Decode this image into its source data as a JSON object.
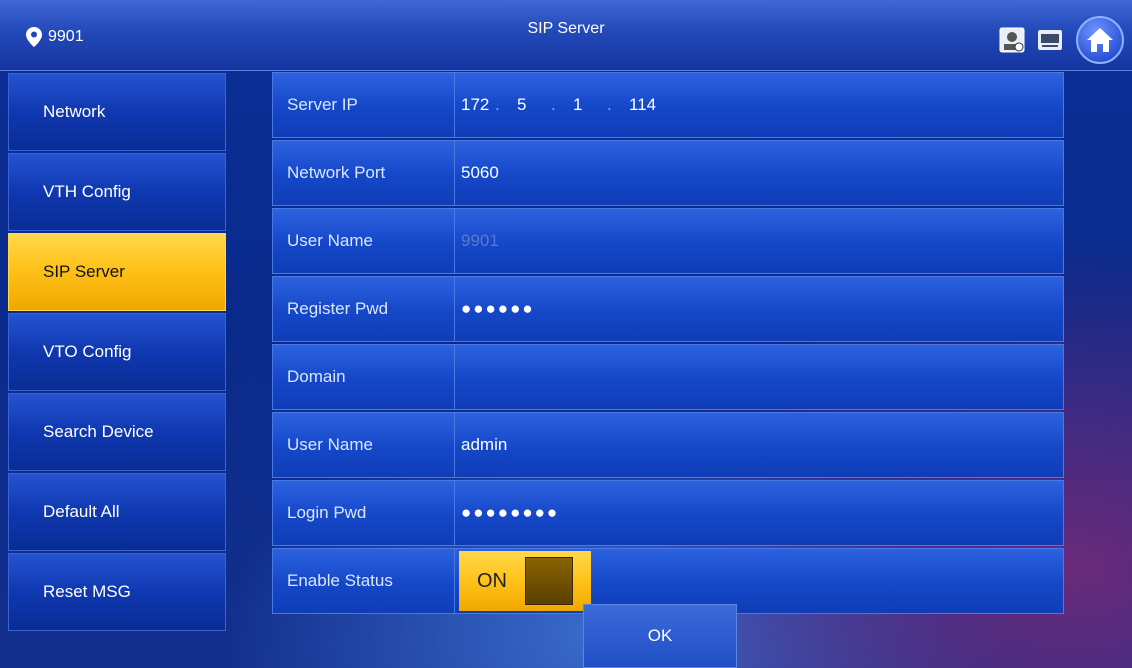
{
  "header": {
    "location_label": "9901",
    "title": "SIP Server",
    "icons": [
      "pin-icon",
      "contact-card-icon",
      "monitor-icon",
      "home-icon"
    ]
  },
  "sidebar": {
    "items": [
      {
        "label": "Network"
      },
      {
        "label": "VTH Config"
      },
      {
        "label": "SIP Server",
        "active": true
      },
      {
        "label": "VTO Config"
      },
      {
        "label": "Search Device"
      },
      {
        "label": "Default All"
      },
      {
        "label": "Reset MSG"
      }
    ]
  },
  "form": {
    "server_ip": {
      "label": "Server IP",
      "octets": [
        "172",
        "5",
        "1",
        "114"
      ],
      "separator": "."
    },
    "network_port": {
      "label": "Network Port",
      "value": "5060"
    },
    "user_name_1": {
      "label": "User Name",
      "value": "9901"
    },
    "register_pwd": {
      "label": "Register Pwd",
      "value": "●●●●●●"
    },
    "domain": {
      "label": "Domain",
      "value": ""
    },
    "user_name_2": {
      "label": "User Name",
      "value": "admin"
    },
    "login_pwd": {
      "label": "Login Pwd",
      "value": "●●●●●●●●"
    },
    "enable_status": {
      "label": "Enable Status",
      "value": "ON"
    }
  },
  "actions": {
    "ok_label": "OK"
  },
  "colors": {
    "active_accent": "#ffc21a",
    "panel_blue": "#1447c8"
  }
}
